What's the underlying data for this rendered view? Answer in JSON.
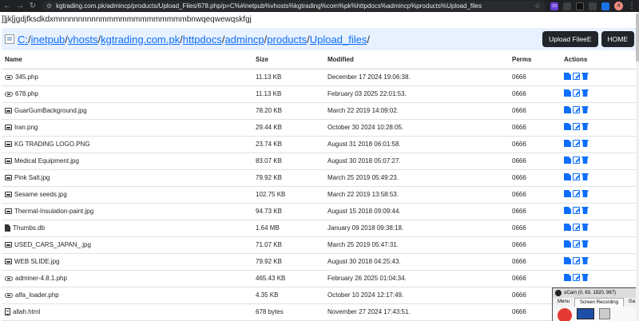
{
  "browser": {
    "url": "kgtrading.com.pk/admincp/products/Upload_Files/678.php/p=C%#inetpub%vhosts%kgtrading%com%pk%httpdocs%admincp%products%Upload_files",
    "back_icon": "arrow-left-icon",
    "forward_icon": "arrow-right-icon",
    "reload_icon": "reload-icon",
    "extension_badge": "10",
    "profile_initial": "4"
  },
  "garbage_text": "]]jk[jgdjfksdkdxmnnnnnnnnnmmmmmmmmmmmmmbnwqeqwewqskfgj",
  "path": {
    "segments": [
      "C:",
      "inetpub",
      "vhosts",
      "kgtrading.com.pk",
      "httpdocs",
      "admincp",
      "products",
      "Upload_files"
    ],
    "separator": "/",
    "upload_button": "Upload FileeE",
    "home_button": "HOME"
  },
  "table": {
    "headers": {
      "name": "Name",
      "size": "Size",
      "modified": "Modified",
      "perms": "Perms",
      "actions": "Actions"
    },
    "rows": [
      {
        "icon": "php",
        "name": "345.php",
        "size": "11.13 KB",
        "modified": "December 17 2024 19:06:38.",
        "perms": "0666"
      },
      {
        "icon": "php",
        "name": "678.php",
        "size": "11.13 KB",
        "modified": "February 03 2025 22:01:53.",
        "perms": "0666"
      },
      {
        "icon": "image",
        "name": "GuarGumBackground.jpg",
        "size": "78.20 KB",
        "modified": "March 22 2019 14:09:02.",
        "perms": "0666"
      },
      {
        "icon": "image",
        "name": "Iran.png",
        "size": "29.44 KB",
        "modified": "October 30 2024 10:28:05.",
        "perms": "0666"
      },
      {
        "icon": "image",
        "name": "KG TRADING LOGO.PNG",
        "size": "23.74 KB",
        "modified": "August 31 2018 06:01:58.",
        "perms": "0666"
      },
      {
        "icon": "image",
        "name": "Medical Equipment.jpg",
        "size": "83.07 KB",
        "modified": "August 30 2018 05:07:27.",
        "perms": "0666"
      },
      {
        "icon": "image",
        "name": "Pink Salt.jpg",
        "size": "79.92 KB",
        "modified": "March 25 2019 05:49:23.",
        "perms": "0666"
      },
      {
        "icon": "image",
        "name": "Sesame seeds.jpg",
        "size": "102.75 KB",
        "modified": "March 22 2019 13:58:53.",
        "perms": "0666"
      },
      {
        "icon": "image",
        "name": "Thermal-Insulation-paint.jpg",
        "size": "94.73 KB",
        "modified": "August 15 2018 09:09:44.",
        "perms": "0666"
      },
      {
        "icon": "file",
        "name": "Thumbs.db",
        "size": "1.64 MB",
        "modified": "January 09 2018 09:38:18.",
        "perms": "0666"
      },
      {
        "icon": "image",
        "name": "USED_CARS_JAPAN_.jpg",
        "size": "71.07 KB",
        "modified": "March 25 2019 05:47:31.",
        "perms": "0666"
      },
      {
        "icon": "image",
        "name": "WEB SLIDE.jpg",
        "size": "79.92 KB",
        "modified": "August 30 2018 04:25:43.",
        "perms": "0666"
      },
      {
        "icon": "php",
        "name": "adminer-4.8.1.php",
        "size": "465.43 KB",
        "modified": "February 26 2025 01:04:34.",
        "perms": "0666"
      },
      {
        "icon": "php",
        "name": "alfa_loader.php",
        "size": "4.35 KB",
        "modified": "October 10 2024 12:17:49.",
        "perms": "0666"
      },
      {
        "icon": "code",
        "name": "allah.html",
        "size": "678 bytes",
        "modified": "November 27 2024 17:43:51.",
        "perms": "0666"
      }
    ]
  },
  "obs": {
    "title": "oCam (0, 63, 1920, 967)",
    "tabs": [
      "Menu",
      "Screen Recording",
      "Ga"
    ]
  }
}
